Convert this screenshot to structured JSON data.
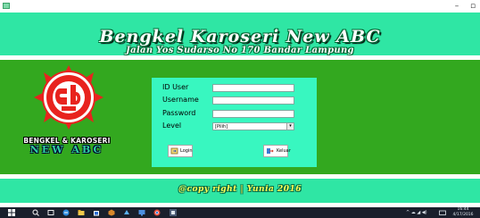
{
  "window": {
    "minimize": "–",
    "maximize": "▫"
  },
  "header": {
    "title": "Bengkel Karoseri New ABC",
    "address": "Jalan Yos Sudarso No 170 Bandar Lampung"
  },
  "logo": {
    "caption": "BENGKEL & KAROSERI",
    "brand": "NEW ABC"
  },
  "login": {
    "id_user_label": "ID User",
    "username_label": "Username",
    "password_label": "Password",
    "level_label": "Level",
    "id_user_value": "",
    "username_value": "",
    "password_value": "",
    "level_selected": "[Pilih]",
    "login_button": "Login",
    "keluar_button": "Keluar"
  },
  "footer": {
    "copyright": "@copy right | Yunia 2016"
  },
  "taskbar": {
    "time": "16:44",
    "date": "4/17/2016"
  },
  "colors": {
    "header_bg": "#2fe6a4",
    "main_bg": "#33a81f",
    "panel_bg": "#38f7c0",
    "logo_red": "#e8231e"
  }
}
